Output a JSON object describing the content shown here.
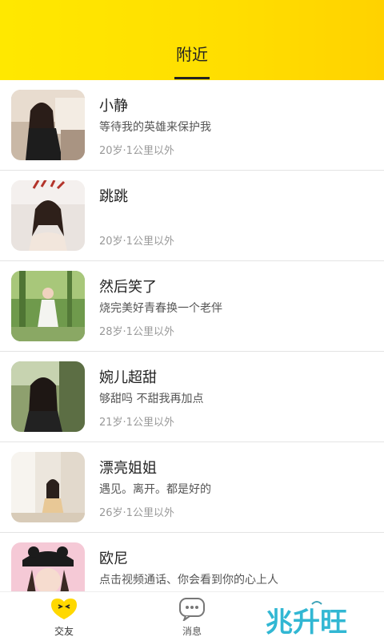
{
  "header": {
    "tab_label": "附近",
    "bg_color": "#ffe500"
  },
  "users": [
    {
      "name": "小静",
      "bio": "等待我的英雄来保护我",
      "meta": "20岁·1公里以外"
    },
    {
      "name": "跳跳",
      "bio": "",
      "meta": "20岁·1公里以外"
    },
    {
      "name": "然后笑了",
      "bio": "烧完美好青春换一个老伴",
      "meta": "28岁·1公里以外"
    },
    {
      "name": "婉儿超甜",
      "bio": "够甜吗 不甜我再加点",
      "meta": "21岁·1公里以外"
    },
    {
      "name": "漂亮姐姐",
      "bio": "遇见。离开。都是好的",
      "meta": "26岁·1公里以外"
    },
    {
      "name": "欧尼",
      "bio": "点击视频通话、你会看到你的心上人",
      "meta": ""
    }
  ],
  "tabbar": {
    "items": [
      {
        "label": "交友",
        "icon": "friends-icon",
        "active": true
      },
      {
        "label": "消息",
        "icon": "message-icon",
        "active": false
      }
    ]
  },
  "watermark": {
    "text": "兆升旺"
  }
}
